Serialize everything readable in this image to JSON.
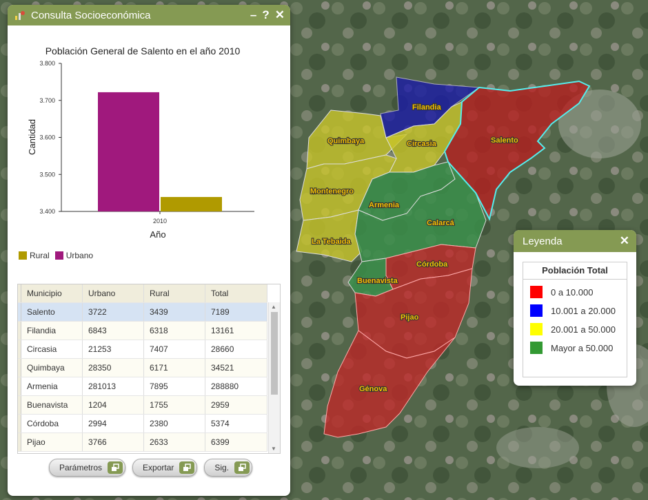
{
  "panel": {
    "title": "Consulta Socioeconómica",
    "minimize": "–",
    "help": "?",
    "close": "✕"
  },
  "chart_data": {
    "type": "bar",
    "title": "Población General de Salento en el año 2010",
    "xlabel": "Año",
    "ylabel": "Cantidad",
    "categories": [
      "2010"
    ],
    "series": [
      {
        "name": "Urbano",
        "values": [
          3722
        ],
        "color": "#a0197d"
      },
      {
        "name": "Rural",
        "values": [
          3439
        ],
        "color": "#b09a00"
      }
    ],
    "ylim": [
      3400,
      3800
    ],
    "yticks": [
      "3.400",
      "3.500",
      "3.600",
      "3.700",
      "3.800"
    ],
    "ytick_values": [
      3400,
      3500,
      3600,
      3700,
      3800
    ],
    "legend_placement": "bottom-left"
  },
  "legend": {
    "rural": "Rural",
    "urbano": "Urbano"
  },
  "table": {
    "columns": [
      "Municipio",
      "Urbano",
      "Rural",
      "Total"
    ],
    "rows": [
      [
        "Salento",
        "3722",
        "3439",
        "7189"
      ],
      [
        "Filandia",
        "6843",
        "6318",
        "13161"
      ],
      [
        "Circasia",
        "21253",
        "7407",
        "28660"
      ],
      [
        "Quimbaya",
        "28350",
        "6171",
        "34521"
      ],
      [
        "Armenia",
        "281013",
        "7895",
        "288880"
      ],
      [
        "Buenavista",
        "1204",
        "1755",
        "2959"
      ],
      [
        "Córdoba",
        "2994",
        "2380",
        "5374"
      ],
      [
        "Pijao",
        "3766",
        "2633",
        "6399"
      ]
    ],
    "selected_row": 0
  },
  "buttons": {
    "params": "Parámetros",
    "export": "Exportar",
    "next": "Sig."
  },
  "map_legend": {
    "title": "Leyenda",
    "close": "✕",
    "subtitle": "Población Total",
    "items": [
      {
        "label": "0 a 10.000",
        "color": "#ff0000"
      },
      {
        "label": "10.001 a 20.000",
        "color": "#0000ff"
      },
      {
        "label": "20.001 a 50.000",
        "color": "#ffff00"
      },
      {
        "label": "Mayor a 50.000",
        "color": "#339933"
      }
    ]
  },
  "map_labels": {
    "filandia": "Filandia",
    "quimbaya": "Quimbaya",
    "circasia": "Circasia",
    "salento": "Salento",
    "montenegro": "Montenegro",
    "armenia": "Armenia",
    "calarca": "Calarcá",
    "latebaida": "La Tebaida",
    "cordoba": "Córdoba",
    "buenavista": "Buenavista",
    "pijao": "Pijao",
    "genova": "Génova"
  }
}
